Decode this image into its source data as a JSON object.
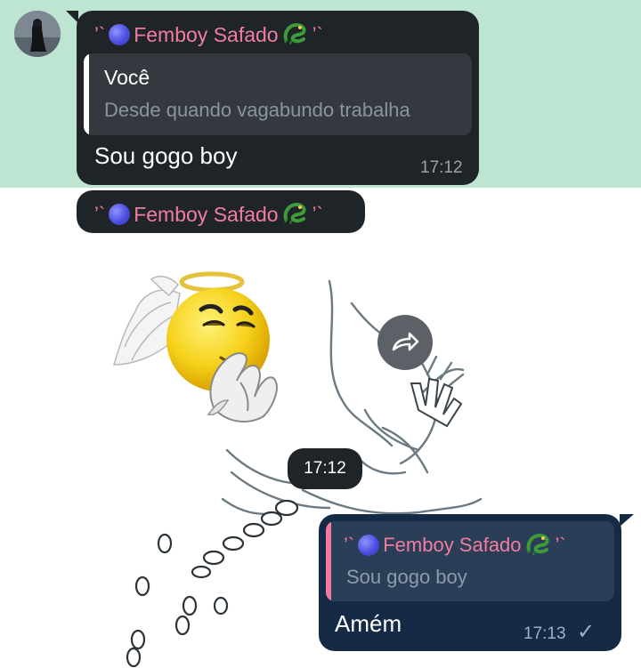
{
  "messages": {
    "first": {
      "sender": "Femboy Safado",
      "reply": {
        "author": "Você",
        "text": "Desde quando vagabundo trabalha"
      },
      "text": "Sou gogo boy",
      "time": "17:12"
    },
    "sticker": {
      "sender": "Femboy Safado",
      "time": "17:12"
    },
    "outgoing": {
      "reply": {
        "author": "Femboy Safado",
        "text": "Sou gogo boy"
      },
      "text": "Amém",
      "time": "17:13",
      "status": "✓"
    }
  },
  "sender_decor": {
    "prefix": "’`",
    "suffix": "’`"
  },
  "icons": {
    "share": "share-icon",
    "avatar": "avatar",
    "dragon": "dragon-emoji",
    "blue_circle": "blue-circle-emoji",
    "read_check": "check-icon"
  },
  "colors": {
    "highlight": "#bde5d2",
    "bubble_dark": "#1f2428",
    "bubble_outgoing": "#152a45",
    "sender_name": "#f07da0",
    "reply_bar_incoming": "#ffffff",
    "reply_bar_outgoing": "#f07da0",
    "meta": "#9aa3ab"
  }
}
